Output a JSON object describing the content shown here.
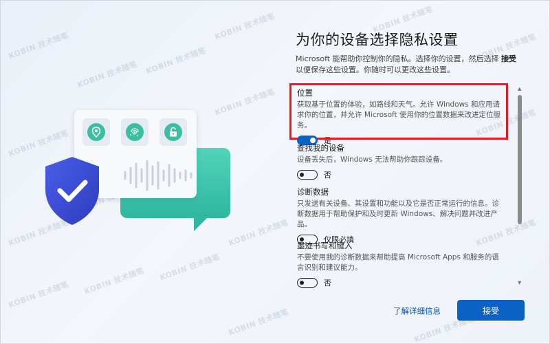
{
  "title": "为你的设备选择隐私设置",
  "description": {
    "part1": "Microsoft 能帮助你控制你的隐私。选择你的设置，然后选择",
    "accept_word": "接受",
    "part2": "以便保存这些设置。你随时可以更改这些设置。"
  },
  "settings": [
    {
      "title": "位置",
      "description": "获取基于位置的体验，如路线和天气。允许 Windows 和应用请求你的位置，并允许 Microsoft 使用你的位置数据来改进定位服务。",
      "state": "on",
      "toggle_label": "是"
    },
    {
      "title": "查找我的设备",
      "description": "设备丢失后，Windows 无法帮助你跟踪设备。",
      "state": "off",
      "toggle_label": "否"
    },
    {
      "title": "诊断数据",
      "description": "只发送有关设备、其设置和功能以及它是否正常运行的信息。诊断数据用于帮助保护和及时更新 Windows、解决问题并改进产品。",
      "state": "off",
      "toggle_label": "仅限必填"
    },
    {
      "title": "墨迹书写和键入",
      "description": "不要使用我的诊断数据来帮助提高 Microsoft Apps 和服务的语言识别和建议能力。",
      "state": "off",
      "toggle_label": "否"
    }
  ],
  "learn_more": "了解详细信息",
  "accept_button": "接受",
  "watermark": "KOBIN 技术随笔",
  "colors": {
    "accent": "#0a62c3",
    "highlight": "#e01b24",
    "illustration_green": "#3bbf9f",
    "shield": "#3f4fd8"
  },
  "icons": [
    "location-pin-icon",
    "fingerprint-icon",
    "lock-icon",
    "shield-check-icon",
    "sound-wave-icon"
  ]
}
